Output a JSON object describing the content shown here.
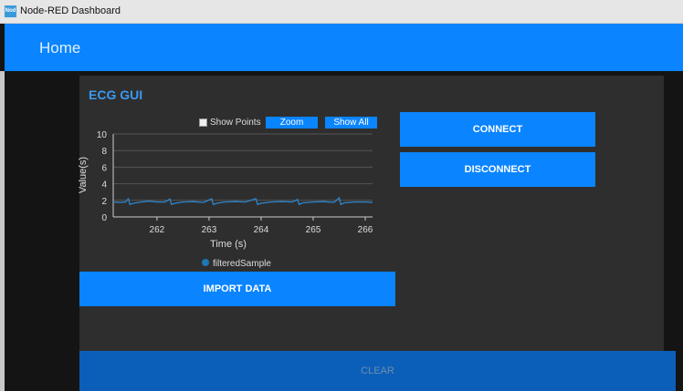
{
  "window": {
    "title": "Node-RED Dashboard",
    "icon": "node-red-icon"
  },
  "header": {
    "title": "Home"
  },
  "group": {
    "title": "ECG GUI"
  },
  "chart_controls": {
    "show_points": "Show Points",
    "show_points_checked": false,
    "zoom": "Zoom",
    "show_all": "Show All"
  },
  "buttons": {
    "connect": "CONNECT",
    "disconnect": "DISCONNECT",
    "import": "IMPORT DATA",
    "clear": "CLEAR"
  },
  "chart_data": {
    "type": "line",
    "xlabel": "Time (s)",
    "ylabel": "Value(s)",
    "xlim": [
      261.16,
      266.14
    ],
    "ylim": [
      0,
      10
    ],
    "xticks": [
      "262",
      "263",
      "264",
      "265",
      "266"
    ],
    "yticks": [
      "0",
      "2",
      "4",
      "6",
      "8",
      "10"
    ],
    "grid": true,
    "legend_position": "bottom",
    "series": [
      {
        "name": "filteredSample",
        "color": "#1f77b4",
        "points": [
          [
            261.16,
            1.8
          ],
          [
            261.3,
            1.75
          ],
          [
            261.4,
            1.8
          ],
          [
            261.45,
            2.2
          ],
          [
            261.48,
            1.5
          ],
          [
            261.55,
            1.65
          ],
          [
            261.7,
            1.8
          ],
          [
            261.85,
            1.9
          ],
          [
            262.0,
            1.8
          ],
          [
            262.15,
            1.8
          ],
          [
            262.25,
            2.15
          ],
          [
            262.28,
            1.5
          ],
          [
            262.35,
            1.65
          ],
          [
            262.5,
            1.8
          ],
          [
            262.7,
            1.85
          ],
          [
            262.9,
            1.75
          ],
          [
            263.05,
            2.2
          ],
          [
            263.08,
            1.5
          ],
          [
            263.15,
            1.65
          ],
          [
            263.3,
            1.8
          ],
          [
            263.5,
            1.85
          ],
          [
            263.7,
            1.8
          ],
          [
            263.9,
            2.2
          ],
          [
            263.93,
            1.5
          ],
          [
            264.0,
            1.65
          ],
          [
            264.2,
            1.8
          ],
          [
            264.4,
            1.85
          ],
          [
            264.6,
            1.8
          ],
          [
            264.7,
            2.1
          ],
          [
            264.73,
            1.5
          ],
          [
            264.8,
            1.7
          ],
          [
            265.0,
            1.8
          ],
          [
            265.2,
            1.85
          ],
          [
            265.4,
            1.75
          ],
          [
            265.5,
            2.3
          ],
          [
            265.53,
            1.5
          ],
          [
            265.6,
            1.7
          ],
          [
            265.8,
            1.8
          ],
          [
            266.0,
            1.8
          ],
          [
            266.14,
            1.75
          ]
        ]
      }
    ]
  }
}
